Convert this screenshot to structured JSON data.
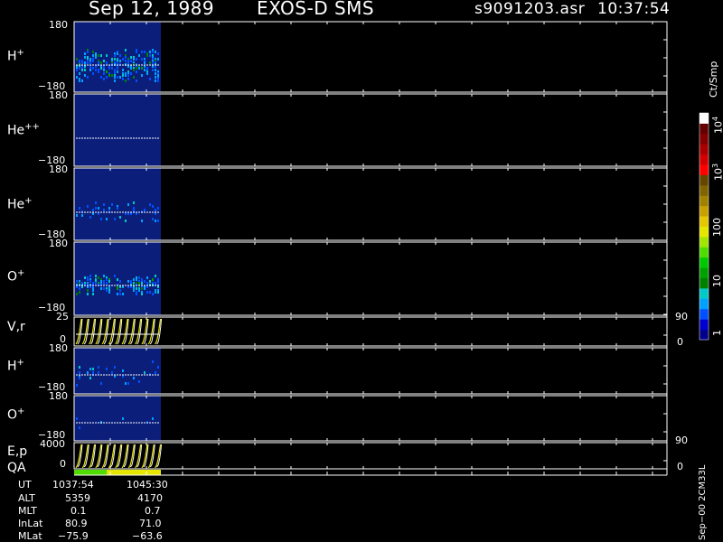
{
  "title": {
    "date": "Sep 12, 1989",
    "instrument": "EXOS-D SMS",
    "file": "s9091203.asr",
    "time": "10:37:54"
  },
  "colorbar": {
    "unit": "Ct/Smp",
    "ticks": [
      "1",
      "10",
      "100",
      "10",
      "3",
      "10",
      "4"
    ],
    "tick_labels": {
      "t1": "1",
      "t10": "10",
      "t100": "100",
      "t1000": "10",
      "t1000_exp": "3",
      "t10000": "10",
      "t10000_exp": "4"
    },
    "colors": [
      "#00008b",
      "#0000cd",
      "#0050ff",
      "#00a0ff",
      "#00c8c8",
      "#008000",
      "#00a000",
      "#00c800",
      "#50dc00",
      "#a0e600",
      "#e6e600",
      "#e6c800",
      "#c8a000",
      "#a08200",
      "#806400",
      "#644600",
      "#ff0000",
      "#d20000",
      "#aa0000",
      "#820000",
      "#640000",
      "#ffffff"
    ]
  },
  "panels": {
    "hplus": {
      "species": "H",
      "charge": "+",
      "ytop": "180",
      "ybot": "−180"
    },
    "hepp": {
      "species": "He",
      "charge": "++",
      "ytop": "180",
      "ybot": "−180"
    },
    "hep": {
      "species": "He",
      "charge": "+",
      "ytop": "180",
      "ybot": "−180"
    },
    "oplus": {
      "species": "O",
      "charge": "+",
      "ytop": "180",
      "ybot": "−180"
    },
    "vr": {
      "label": "V,r",
      "ytop": "25",
      "ybot": "0",
      "rtop": "90",
      "rbot": "0"
    },
    "hplus2": {
      "species": "H",
      "charge": "+",
      "ytop": "180",
      "ybot": "−180"
    },
    "oplus2": {
      "species": "O",
      "charge": "+",
      "ytop": "180",
      "ybot": "−180"
    },
    "ep": {
      "label": "E,p",
      "ytop": "4000",
      "ybot": "0",
      "rtop": "90",
      "rbot": "0"
    },
    "qa": {
      "label": "QA"
    }
  },
  "footer": {
    "rows": [
      {
        "name": "UT",
        "v1": "1037:54",
        "v2": "1045:30"
      },
      {
        "name": "ALT",
        "v1": "5359",
        "v2": "4170"
      },
      {
        "name": "MLT",
        "v1": "0.1",
        "v2": "0.7"
      },
      {
        "name": "InLat",
        "v1": "80.9",
        "v2": "71.0"
      },
      {
        "name": "MLat",
        "v1": "−75.9",
        "v2": "−63.6"
      }
    ],
    "version": "Sep−00 2CM33L"
  },
  "chart_data": {
    "type": "heatmap",
    "title": "Sep 12, 1989   EXOS-D SMS",
    "x": {
      "label": "UT",
      "start": "1037:54",
      "end": "1045:30"
    },
    "panels": [
      "H+ pitch angle",
      "He++ pitch angle",
      "He+ pitch angle",
      "O+ pitch angle",
      "V,r",
      "H+",
      "O+",
      "E,p",
      "QA"
    ],
    "pitch_angle_range": [
      -180,
      180
    ],
    "color_scale": {
      "unit": "Ct/Smp",
      "log": true,
      "range": [
        1,
        10000
      ]
    },
    "ephemeris": {
      "UT": [
        "1037:54",
        "1045:30"
      ],
      "ALT": [
        5359,
        4170
      ],
      "MLT": [
        0.1,
        0.7
      ],
      "InLat": [
        80.9,
        71.0
      ],
      "MLat": [
        -75.9,
        -63.6
      ]
    }
  }
}
